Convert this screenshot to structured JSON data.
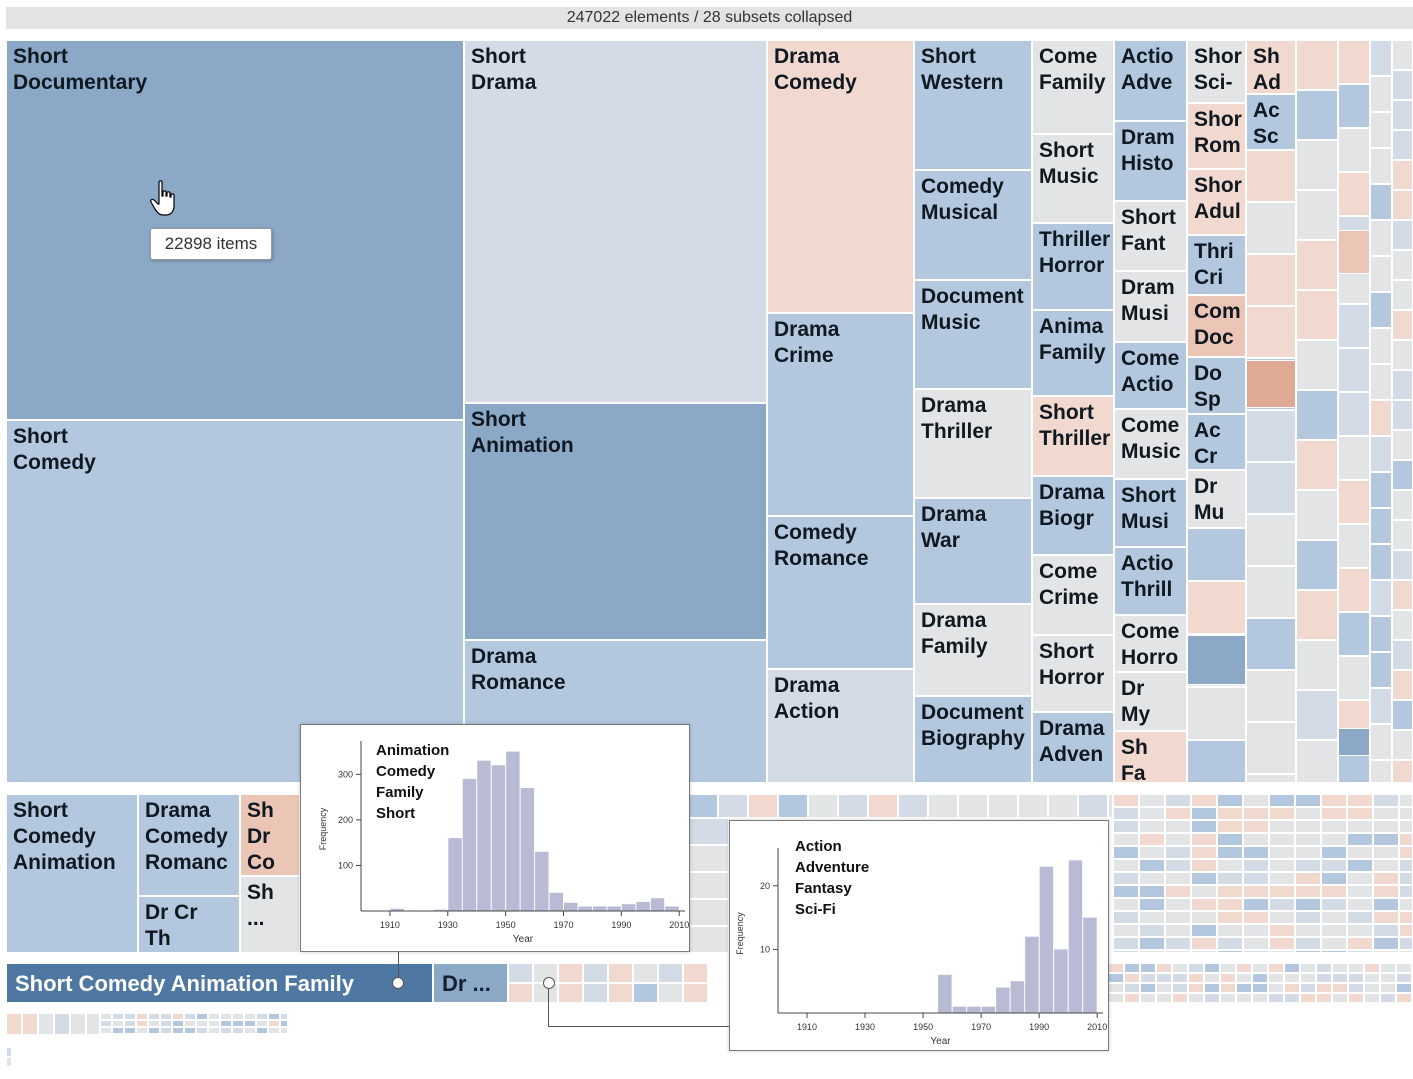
{
  "header": {
    "summary": "247022 elements / 28 subsets collapsed"
  },
  "tooltip": {
    "text": "22898 items"
  },
  "colors": {
    "blue_dark": "#4e77a2",
    "blue_mid": "#8ba8c7",
    "blue_light": "#b3c8df",
    "blue_pale": "#d3dce6",
    "neutral": "#e3e4e6",
    "pink_light": "#f1d9cf",
    "pink_mid": "#ebc5b6",
    "pink_dark": "#dfaa93",
    "bar_fill": "#b9bbd4"
  },
  "chart_data": [
    {
      "type": "treemap",
      "tiles": [
        {
          "id": "t1",
          "label": "Short\nDocumentary",
          "items": 22898,
          "color": "blue_mid"
        },
        {
          "id": "t2",
          "label": "Short\nComedy",
          "color": "blue_light"
        },
        {
          "id": "t3",
          "label": "Short\nDrama",
          "color": "blue_pale"
        },
        {
          "id": "t4",
          "label": "Short\nAnimation",
          "color": "blue_mid"
        },
        {
          "id": "t5",
          "label": "Drama\nRomance",
          "color": "blue_light"
        },
        {
          "id": "t6",
          "label": "Drama\nComedy",
          "color": "pink_light"
        },
        {
          "id": "t7",
          "label": "Drama\nCrime",
          "color": "blue_light"
        },
        {
          "id": "t8",
          "label": "Comedy\nRomance",
          "color": "blue_light"
        },
        {
          "id": "t9",
          "label": "Drama\nAction",
          "color": "blue_pale"
        },
        {
          "id": "t10",
          "label": "Short\nWestern",
          "color": "blue_light"
        },
        {
          "id": "t11",
          "label": "Comedy\nMusical",
          "color": "blue_light"
        },
        {
          "id": "t12",
          "label": "Document\nMusic",
          "color": "blue_light"
        },
        {
          "id": "t13",
          "label": "Drama\nThriller",
          "color": "neutral"
        },
        {
          "id": "t14",
          "label": "Drama\nWar",
          "color": "blue_light"
        },
        {
          "id": "t15",
          "label": "Drama\nFamily",
          "color": "neutral"
        },
        {
          "id": "t16",
          "label": "Document\nBiography",
          "color": "blue_light"
        },
        {
          "id": "t17",
          "label": "Come\nFamily",
          "color": "neutral"
        },
        {
          "id": "t18",
          "label": "Short\nMusic",
          "color": "neutral"
        },
        {
          "id": "t19",
          "label": "Thriller\nHorror",
          "color": "blue_light"
        },
        {
          "id": "t20",
          "label": "Anima\nFamily",
          "color": "blue_light"
        },
        {
          "id": "t21",
          "label": "Short\nThriller",
          "color": "pink_light"
        },
        {
          "id": "t22",
          "label": "Drama\nBiogr",
          "color": "blue_light"
        },
        {
          "id": "t23",
          "label": "Come\nCrime",
          "color": "neutral"
        },
        {
          "id": "t24",
          "label": "Short\nHorror",
          "color": "neutral"
        },
        {
          "id": "t25",
          "label": "Drama\nAdven",
          "color": "blue_light"
        },
        {
          "id": "t26",
          "label": "Actio\nAdve",
          "color": "blue_light"
        },
        {
          "id": "t27",
          "label": "Dram\nHisto",
          "color": "blue_light"
        },
        {
          "id": "t28",
          "label": "Short\nFant",
          "color": "neutral"
        },
        {
          "id": "t29",
          "label": "Dram\nMusi",
          "color": "neutral"
        },
        {
          "id": "t30",
          "label": "Come\nActio",
          "color": "blue_light"
        },
        {
          "id": "t31",
          "label": "Come\nMusic",
          "color": "neutral"
        },
        {
          "id": "t32",
          "label": "Short\nMusi",
          "color": "blue_light"
        },
        {
          "id": "t33",
          "label": "Actio\nThrill",
          "color": "blue_light"
        },
        {
          "id": "t34",
          "label": "Come\nHorro",
          "color": "neutral"
        },
        {
          "id": "t35",
          "label": "Dr\nMy",
          "color": "neutral"
        },
        {
          "id": "t36",
          "label": "Sh\nFa",
          "color": "pink_light"
        },
        {
          "id": "t37",
          "label": "Shor\nSci-",
          "color": "neutral"
        },
        {
          "id": "t38",
          "label": "Shor\nRom",
          "color": "pink_light"
        },
        {
          "id": "t39",
          "label": "Shor\nAdul",
          "color": "pink_light"
        },
        {
          "id": "t40",
          "label": "Thri\nCri",
          "color": "blue_light"
        },
        {
          "id": "t41",
          "label": "Com\nDoc",
          "color": "pink_mid"
        },
        {
          "id": "t42",
          "label": "Do\nSp",
          "color": "blue_light"
        },
        {
          "id": "t43",
          "label": "Ac\nCr",
          "color": "blue_light"
        },
        {
          "id": "t44",
          "label": "Dr\nMu",
          "color": "neutral"
        },
        {
          "id": "t45",
          "label": "Sh\nAd",
          "color": "pink_light"
        },
        {
          "id": "t46",
          "label": "Ac\nSc",
          "color": "blue_light"
        },
        {
          "id": "t47",
          "label": "Short\nComedy\nAnimation",
          "color": "blue_light"
        },
        {
          "id": "t48",
          "label": "Drama\nComedy\nRomanc",
          "color": "blue_light"
        },
        {
          "id": "t49",
          "label": "Sh\nDr\nCo",
          "color": "pink_mid"
        },
        {
          "id": "t50",
          "label": "Dr Cr\nTh",
          "color": "blue_light"
        },
        {
          "id": "t51",
          "label": "Sh\n...",
          "color": "neutral"
        },
        {
          "id": "t52",
          "label": "Short Comedy Animation Family",
          "color": "blue_dark"
        },
        {
          "id": "t53",
          "label": "Dr ...",
          "color": "blue_mid"
        }
      ]
    },
    {
      "type": "bar",
      "title": "Animation\nComedy\nFamily\nShort",
      "xlabel": "Year",
      "ylabel": "Frequency",
      "xlim": [
        1900,
        2012
      ],
      "ylim": [
        0,
        360
      ],
      "xticks": [
        1910,
        1930,
        1950,
        1970,
        1990,
        2010
      ],
      "yticks": [
        100,
        200,
        300
      ],
      "bin_width": 5,
      "bins": [
        1900,
        1905,
        1910,
        1915,
        1920,
        1925,
        1930,
        1935,
        1940,
        1945,
        1950,
        1955,
        1960,
        1965,
        1970,
        1975,
        1980,
        1985,
        1990,
        1995,
        2000,
        2005
      ],
      "values": [
        0,
        0,
        5,
        0,
        0,
        3,
        160,
        290,
        330,
        320,
        350,
        270,
        130,
        40,
        18,
        10,
        10,
        10,
        15,
        20,
        28,
        10
      ]
    },
    {
      "type": "bar",
      "title": "Action\nAdventure\nFantasy\nSci-Fi",
      "xlabel": "Year",
      "ylabel": "Frequency",
      "xlim": [
        1900,
        2012
      ],
      "ylim": [
        0,
        25
      ],
      "xticks": [
        1910,
        1930,
        1950,
        1970,
        1990,
        2010
      ],
      "yticks": [
        10,
        20
      ],
      "bin_width": 5,
      "bins": [
        1955,
        1960,
        1965,
        1970,
        1975,
        1980,
        1985,
        1990,
        1995,
        2000,
        2005
      ],
      "values": [
        6,
        1,
        1,
        1,
        4,
        5,
        12,
        23,
        10,
        24,
        15
      ]
    }
  ]
}
